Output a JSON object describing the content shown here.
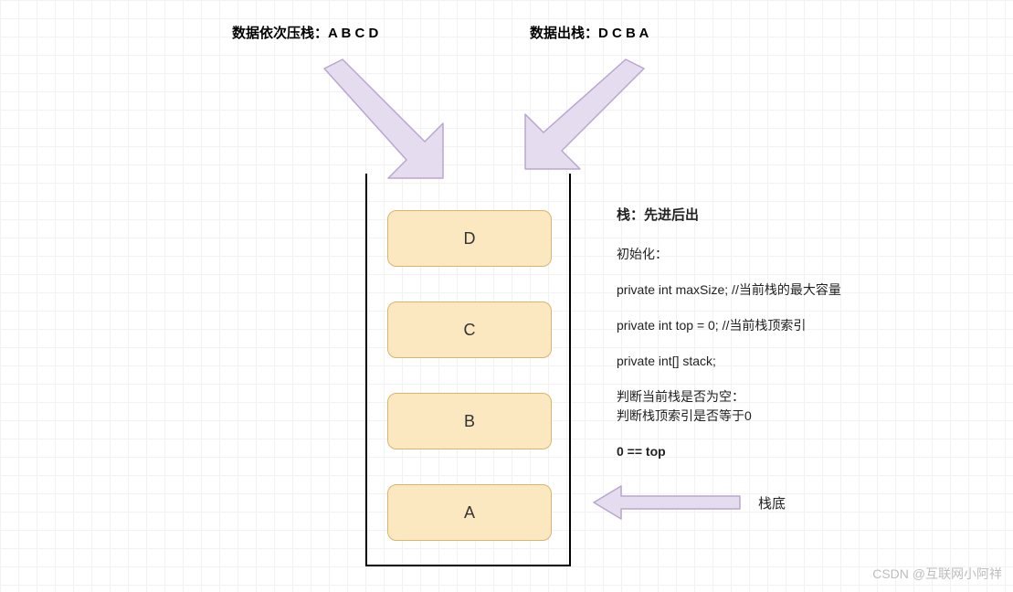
{
  "headings": {
    "push": "数据依次压栈：A B C D",
    "pop": "数据出栈：D C B A"
  },
  "stack": {
    "cells": [
      "D",
      "C",
      "B",
      "A"
    ]
  },
  "notes": {
    "title": "栈：先进后出",
    "init_label": "初始化：",
    "init_line1": "private int maxSize; //当前栈的最大容量",
    "init_line2": "private int top = 0; //当前栈顶索引",
    "init_line3": "private int[] stack;",
    "empty_label": "判断当前栈是否为空：",
    "empty_line1": "判断栈顶索引是否等于0",
    "empty_cond": "0 == top"
  },
  "bottom_label": "栈底",
  "watermark": "CSDN @互联网小阿祥",
  "colors": {
    "cell_fill": "#fbe8c1",
    "cell_border": "#d8b56a",
    "arrow_fill": "#e6dcf0",
    "arrow_stroke": "#b8a6cf"
  }
}
